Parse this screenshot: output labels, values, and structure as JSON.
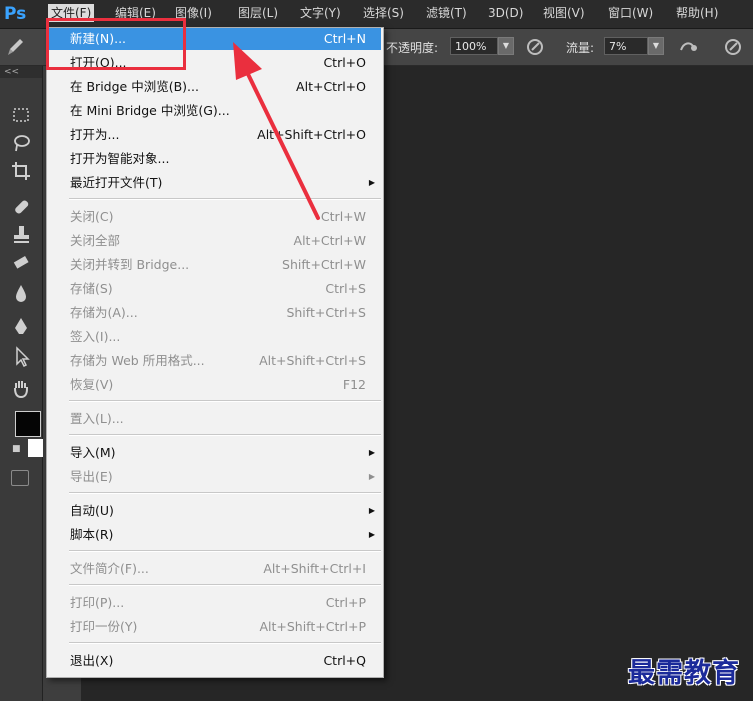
{
  "app": {
    "logo": "Ps"
  },
  "menubar": {
    "items": [
      {
        "label": "文件(F)"
      },
      {
        "label": "编辑(E)"
      },
      {
        "label": "图像(I)"
      },
      {
        "label": "图层(L)"
      },
      {
        "label": "文字(Y)"
      },
      {
        "label": "选择(S)"
      },
      {
        "label": "滤镜(T)"
      },
      {
        "label": "3D(D)"
      },
      {
        "label": "视图(V)"
      },
      {
        "label": "窗口(W)"
      },
      {
        "label": "帮助(H)"
      }
    ]
  },
  "options": {
    "opacity_label": "不透明度:",
    "opacity_value": "100%",
    "flow_label": "流量:",
    "flow_value": "7%"
  },
  "toolbox": {
    "collapse": "<<"
  },
  "file_menu": {
    "items": [
      {
        "label": "新建(N)...",
        "shortcut": "Ctrl+N",
        "state": "highlighted"
      },
      {
        "label": "打开(O)...",
        "shortcut": "Ctrl+O",
        "state": "enabled"
      },
      {
        "label": "在 Bridge 中浏览(B)...",
        "shortcut": "Alt+Ctrl+O",
        "state": "enabled"
      },
      {
        "label": "在 Mini Bridge 中浏览(G)...",
        "shortcut": "",
        "state": "enabled"
      },
      {
        "label": "打开为...",
        "shortcut": "Alt+Shift+Ctrl+O",
        "state": "enabled"
      },
      {
        "label": "打开为智能对象...",
        "shortcut": "",
        "state": "enabled"
      },
      {
        "label": "最近打开文件(T)",
        "shortcut": "",
        "state": "enabled",
        "submenu": true
      },
      {
        "label": "关闭(C)",
        "shortcut": "Ctrl+W",
        "state": "disabled"
      },
      {
        "label": "关闭全部",
        "shortcut": "Alt+Ctrl+W",
        "state": "disabled"
      },
      {
        "label": "关闭并转到 Bridge...",
        "shortcut": "Shift+Ctrl+W",
        "state": "disabled"
      },
      {
        "label": "存储(S)",
        "shortcut": "Ctrl+S",
        "state": "disabled"
      },
      {
        "label": "存储为(A)...",
        "shortcut": "Shift+Ctrl+S",
        "state": "disabled"
      },
      {
        "label": "签入(I)...",
        "shortcut": "",
        "state": "disabled"
      },
      {
        "label": "存储为 Web 所用格式...",
        "shortcut": "Alt+Shift+Ctrl+S",
        "state": "disabled"
      },
      {
        "label": "恢复(V)",
        "shortcut": "F12",
        "state": "disabled"
      },
      {
        "label": "置入(L)...",
        "shortcut": "",
        "state": "disabled"
      },
      {
        "label": "导入(M)",
        "shortcut": "",
        "state": "enabled",
        "submenu": true
      },
      {
        "label": "导出(E)",
        "shortcut": "",
        "state": "disabled",
        "submenu": true
      },
      {
        "label": "自动(U)",
        "shortcut": "",
        "state": "enabled",
        "submenu": true
      },
      {
        "label": "脚本(R)",
        "shortcut": "",
        "state": "enabled",
        "submenu": true
      },
      {
        "label": "文件简介(F)...",
        "shortcut": "Alt+Shift+Ctrl+I",
        "state": "disabled"
      },
      {
        "label": "打印(P)...",
        "shortcut": "Ctrl+P",
        "state": "disabled"
      },
      {
        "label": "打印一份(Y)",
        "shortcut": "Alt+Shift+Ctrl+P",
        "state": "disabled"
      },
      {
        "label": "退出(X)",
        "shortcut": "Ctrl+Q",
        "state": "enabled"
      }
    ]
  },
  "watermark": {
    "text": "最需教育"
  },
  "colors": {
    "highlight": "#3a93e2",
    "annotation_red": "#ea2f3e",
    "watermark": "#1b2a9a",
    "logo": "#3aa3ff"
  }
}
